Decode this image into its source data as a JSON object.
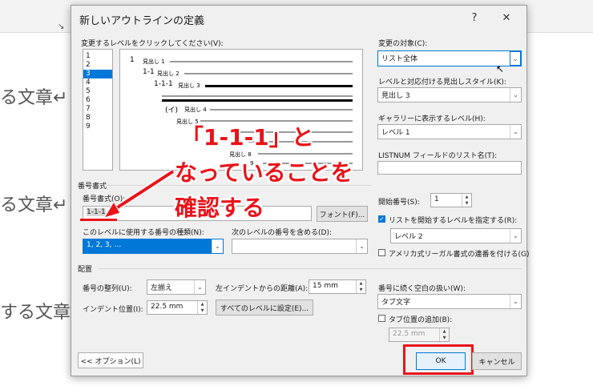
{
  "background_doc": {
    "lines": [
      "る文章↵",
      "る文章↵",
      "する文章"
    ],
    "fragment_icon": "resize-corner-icon"
  },
  "dialog": {
    "title": "新しいアウトラインの定義",
    "help_label": "?",
    "close_label": "✕",
    "level_click_label": "変更するレベルをクリックしてください(V):",
    "levels": [
      "1",
      "2",
      "3",
      "4",
      "5",
      "6",
      "7",
      "8",
      "9"
    ],
    "selected_level": "3",
    "preview": {
      "items": [
        {
          "num": "1",
          "label": "見出し 1"
        },
        {
          "num": "1-1",
          "label": "見出し 2"
        },
        {
          "num": "1-1-1",
          "label": "見出し 3"
        },
        {
          "num": "(イ)",
          "label": "見出し 4"
        },
        {
          "num": "",
          "label": "見出し 5"
        },
        {
          "num": "",
          "label": "6"
        },
        {
          "num": "",
          "label": "見出し 8"
        },
        {
          "num": "",
          "label": "9"
        }
      ]
    },
    "apply_to_label": "変更の対象(C):",
    "apply_to_value": "リスト全体",
    "link_style_label": "レベルと対応付ける見出しスタイル(K):",
    "link_style_value": "見出し 3",
    "gallery_level_label": "ギャラリーに表示するレベル(H):",
    "gallery_level_value": "レベル 1",
    "listnum_label": "LISTNUM フィールドのリスト名(T):",
    "listnum_value": "",
    "number_format_group": "番号書式",
    "number_format_label": "番号書式(O):",
    "number_format_value": "1-1-1",
    "font_button": "フォント(F)...",
    "number_style_label": "このレベルに使用する番号の種類(N):",
    "number_style_value": "1, 2, 3, …",
    "include_level_label": "次のレベルの番号を含める(D):",
    "include_level_value": "",
    "start_at_label": "開始番号(S):",
    "start_at_value": "1",
    "restart_label": "リストを開始するレベルを指定する(R):",
    "restart_checked": true,
    "restart_value": "レベル 2",
    "legal_label": "アメリカ式リーガル書式の連番を付ける(G)",
    "legal_checked": false,
    "position_group": "配置",
    "alignment_label": "番号の整列(U):",
    "alignment_value": "左揃え",
    "aligned_at_label": "左インデントからの距離(A):",
    "aligned_at_value": "15 mm",
    "indent_label": "インデント位置(I):",
    "indent_value": "22.5 mm",
    "set_all_button": "すべてのレベルに設定(E)...",
    "follow_label": "番号に続く空白の扱い(W):",
    "follow_value": "タブ文字",
    "tab_stop_label": "タブ位置の追加(B):",
    "tab_stop_checked": false,
    "tab_stop_value": "22.5 mm",
    "options_button": "<< オプション(L)",
    "ok_button": "OK",
    "cancel_button": "キャンセル"
  },
  "annotation": {
    "line1": "「1-1-1」と",
    "line2": "なっていることを",
    "line3": "確認する",
    "color": "#e8141b"
  }
}
